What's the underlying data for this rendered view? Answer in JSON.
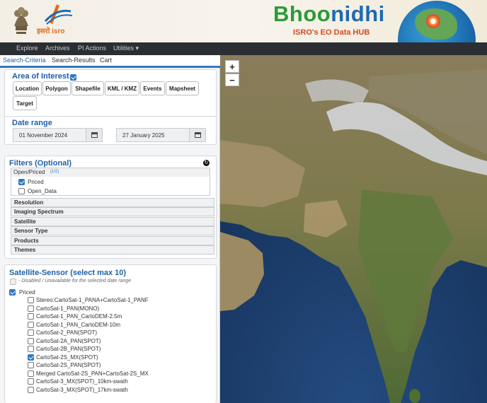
{
  "header": {
    "isro_wordmark": "इसरो isro",
    "brand_part1": "Bhoo",
    "brand_part2": "nidhi",
    "subtitle": "ISRO's EO Data HUB"
  },
  "nav": {
    "items": [
      "Explore",
      "Archives",
      "PI Actions",
      "Utilities"
    ]
  },
  "tabs": [
    "Search-Criteria",
    "Search-Results",
    "Cart"
  ],
  "aoi": {
    "title": "Area of Interest",
    "checked": true,
    "buttons": [
      "Location",
      "Polygon",
      "Shapefile",
      "KML / KMZ",
      "Events",
      "Mapsheet",
      "Target"
    ]
  },
  "date_range": {
    "title": "Date range",
    "start": "01 November 2024",
    "end": "27 January 2025"
  },
  "filters": {
    "title": "Filters (Optional)",
    "open_priced": {
      "label": "Open/Priced",
      "count": "(1/2)",
      "options": [
        {
          "label": "Priced",
          "checked": true
        },
        {
          "label": "Open_Data",
          "checked": false
        }
      ]
    },
    "groups": [
      "Resolution",
      "Imaging Spectrum",
      "Satellite",
      "Sensor Type",
      "Products",
      "Themes"
    ]
  },
  "satellite_sensor": {
    "title": "Satellite-Sensor (select max 10)",
    "disabled_note": "- Disabled / Unavailable for the selected date range",
    "group_label": "Priced",
    "items": [
      {
        "label": "Stereo:CartoSat-1_PANA+CartoSat-1_PANF",
        "checked": false
      },
      {
        "label": "CartoSat-1_PAN(MONO)",
        "checked": false
      },
      {
        "label": "CartoSat-1_PAN_CartoDEM-2.5m",
        "checked": false
      },
      {
        "label": "CartoSat-1_PAN_CartoDEM-10m",
        "checked": false
      },
      {
        "label": "CartoSat-2_PAN(SPOT)",
        "checked": false
      },
      {
        "label": "CartoSat-2A_PAN(SPOT)",
        "checked": false
      },
      {
        "label": "CartoSat-2B_PAN(SPOT)",
        "checked": false
      },
      {
        "label": "CartoSat-2S_MX(SPOT)",
        "checked": true
      },
      {
        "label": "CartoSat-2S_PAN(SPOT)",
        "checked": false
      },
      {
        "label": "Merged CartoSat-2S_PAN+CartoSat-2S_MX",
        "checked": false
      },
      {
        "label": "CartoSat-3_MX(SPOT)_10km-swath",
        "checked": false
      },
      {
        "label": "CartoSat-3_MX(SPOT)_17km-swath",
        "checked": false
      }
    ]
  },
  "map": {
    "zoom_in": "+",
    "zoom_out": "−"
  },
  "colors": {
    "accent": "#2f79c2",
    "title": "#1f5fa8",
    "nav_bg": "#2b2f33"
  }
}
